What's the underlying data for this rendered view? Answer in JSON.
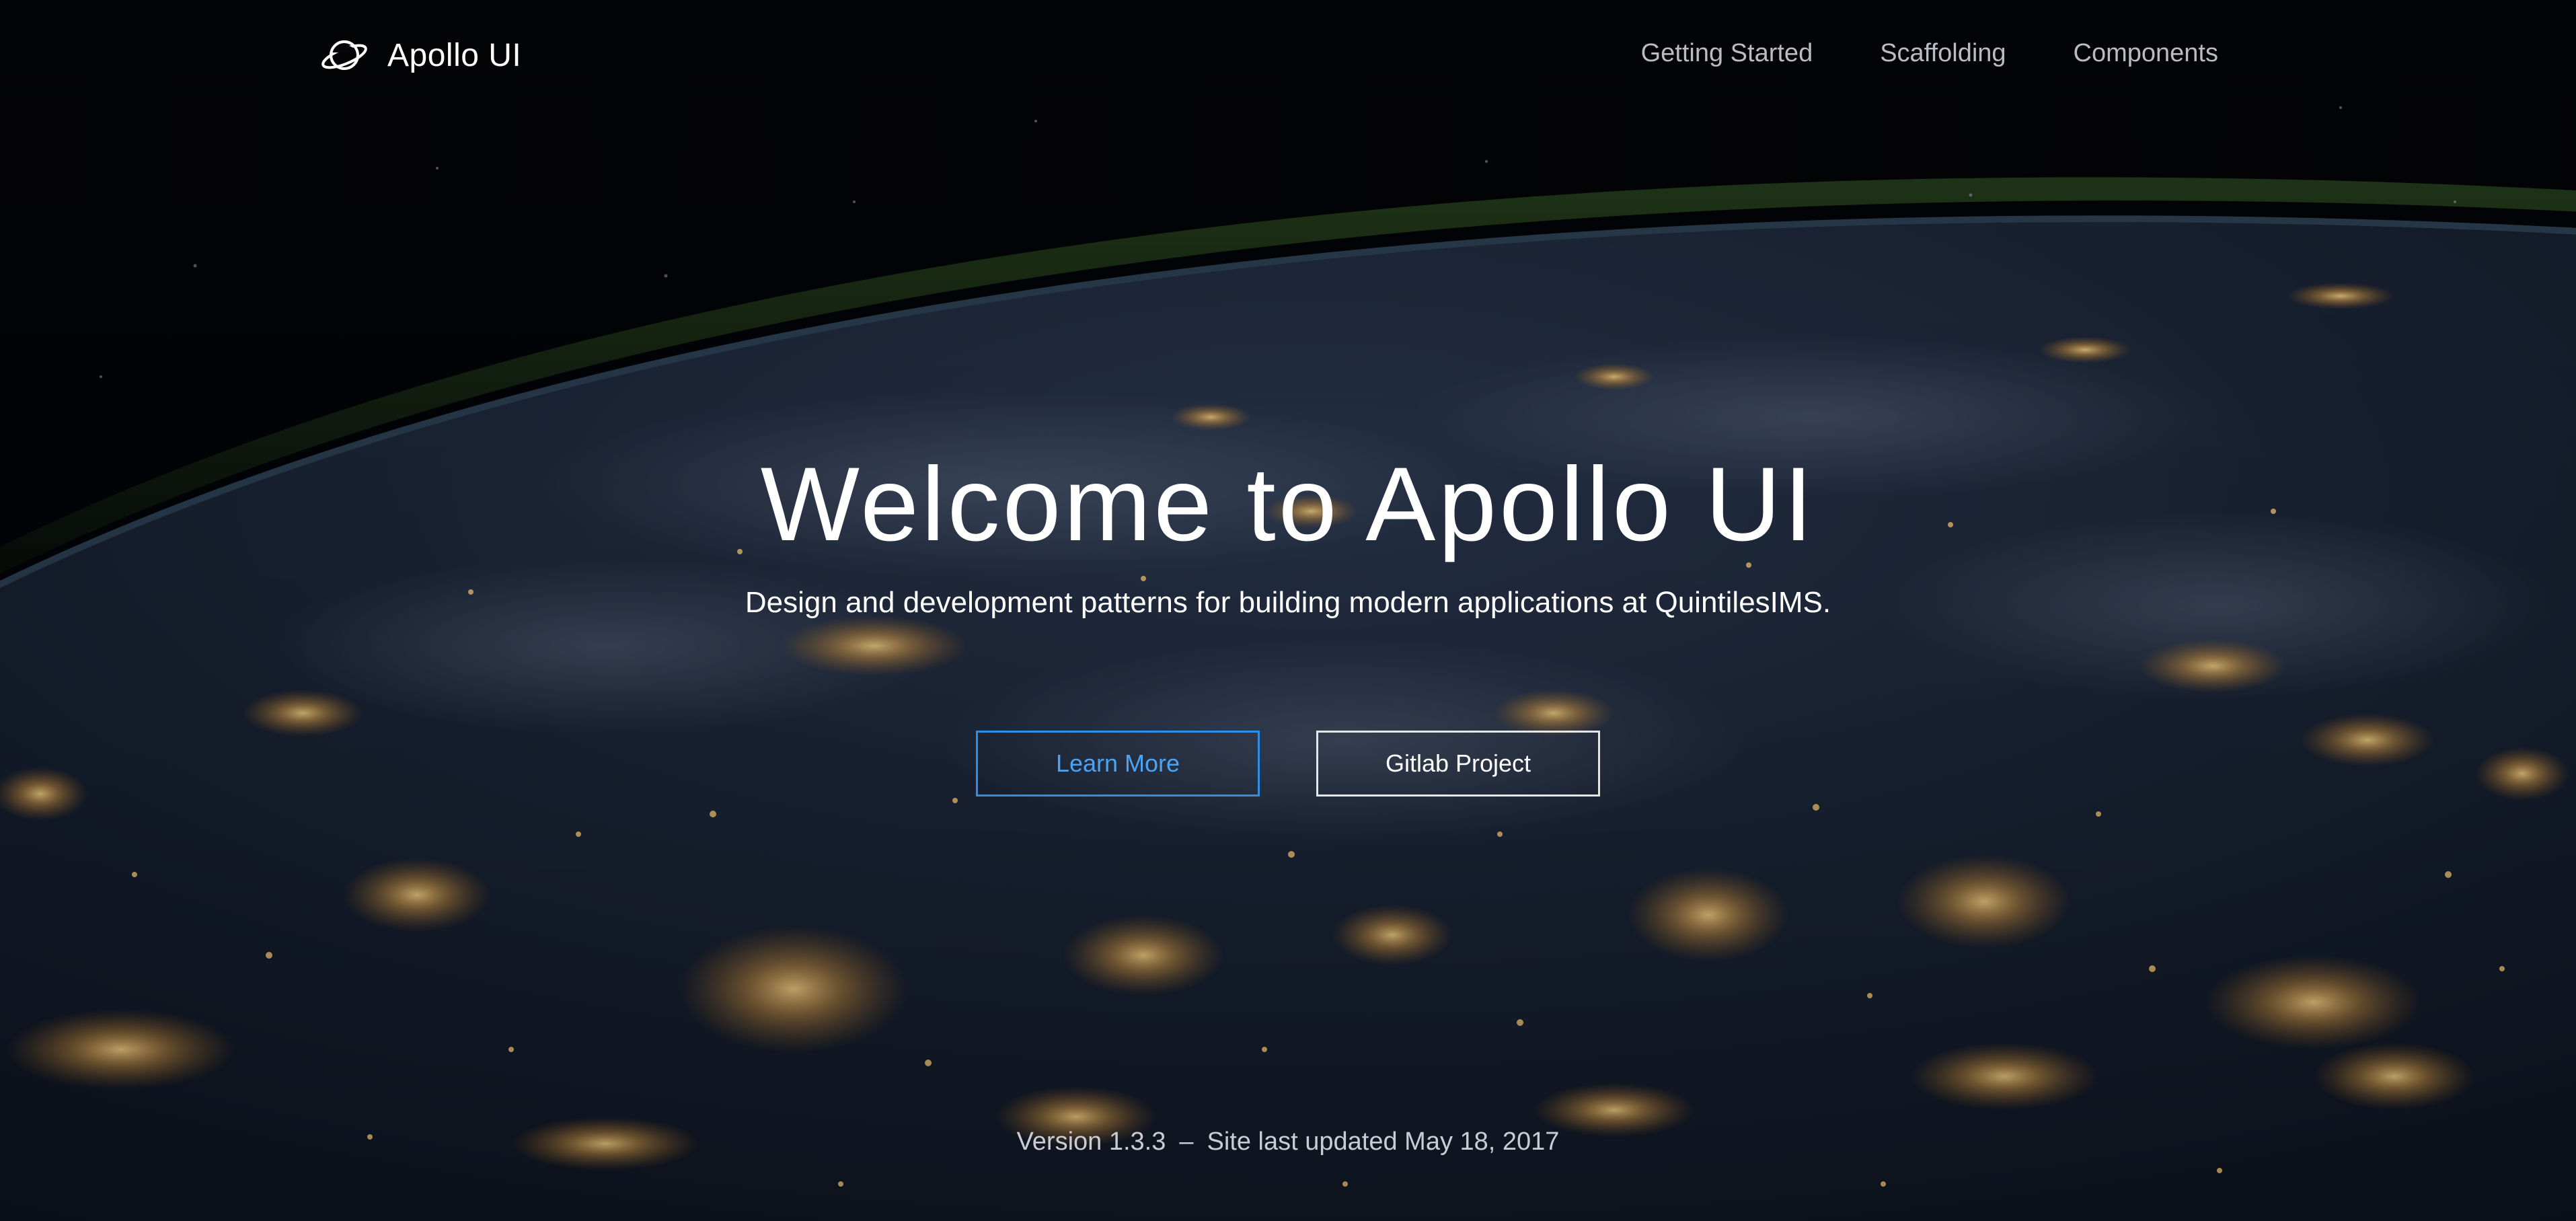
{
  "header": {
    "brand_name": "Apollo UI",
    "brand_icon": "planet-icon",
    "nav": [
      {
        "label": "Getting Started"
      },
      {
        "label": "Scaffolding"
      },
      {
        "label": "Components"
      }
    ]
  },
  "hero": {
    "title": "Welcome to Apollo UI",
    "subtitle": "Design and development patterns for building modern applications at QuintilesIMS.",
    "primary_button": "Learn More",
    "secondary_button": "Gitlab Project"
  },
  "footer": {
    "version": "Version 1.3.3",
    "separator": "–",
    "updated": "Site last updated May 18, 2017"
  },
  "colors": {
    "accent": "#2f8fe6",
    "background": "#04060a",
    "text": "#ffffff"
  }
}
